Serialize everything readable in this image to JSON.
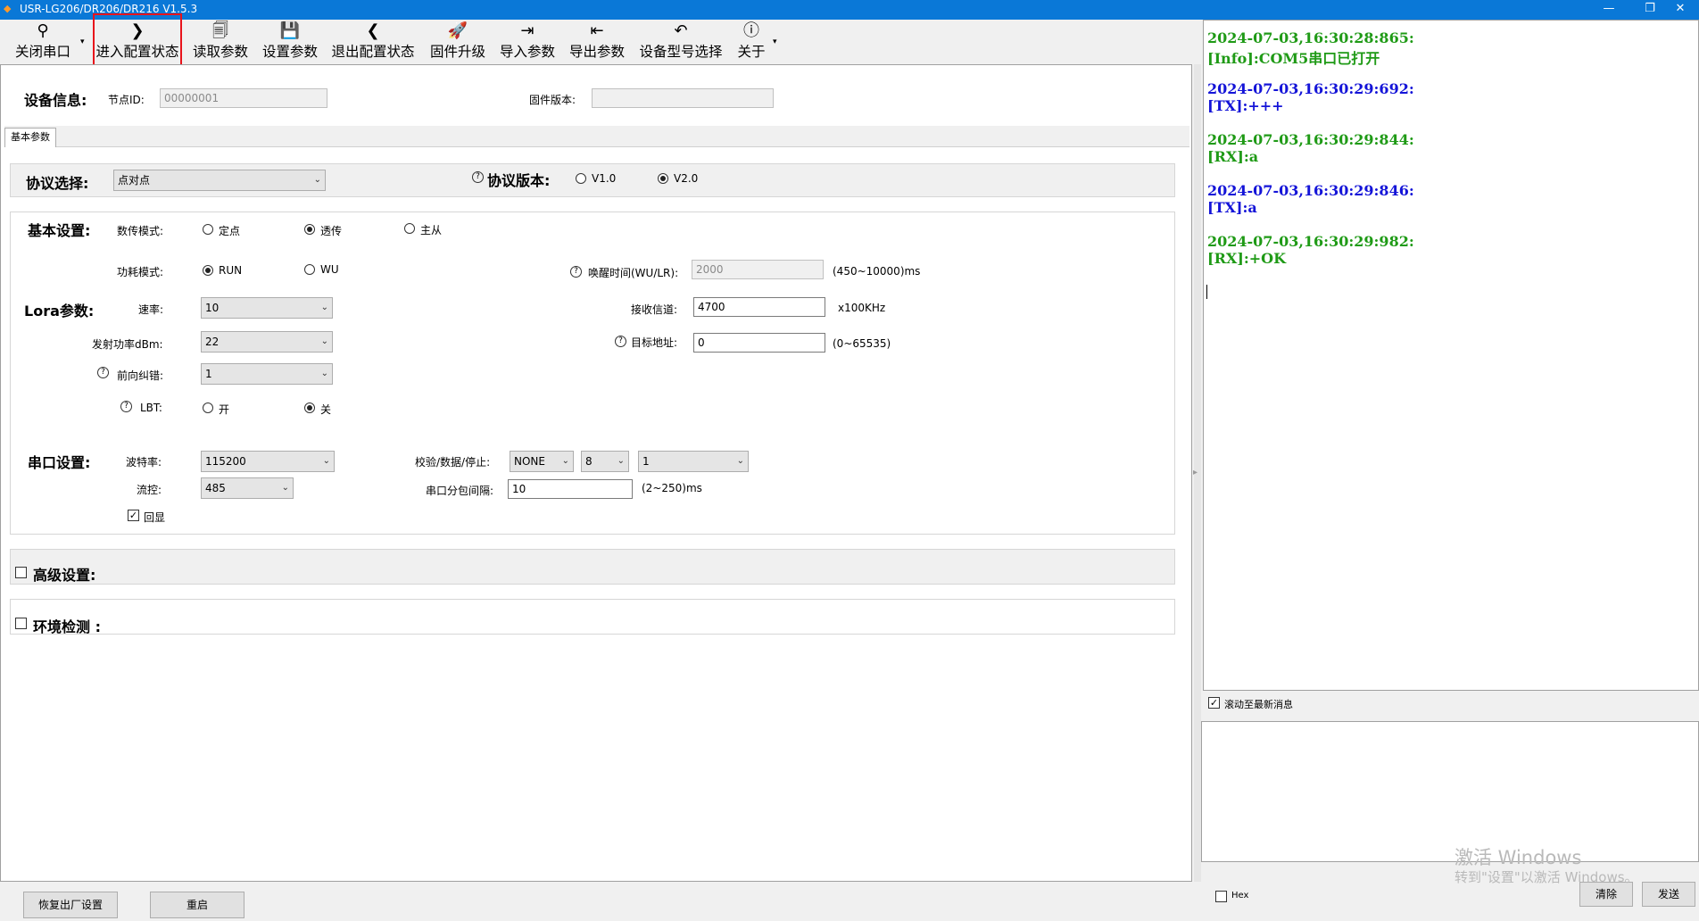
{
  "window": {
    "title": "USR-LG206/DR206/DR216 V1.5.3",
    "minimize": "—",
    "restore": "❐",
    "close": "✕"
  },
  "toolbar": {
    "items": [
      {
        "label": "关闭串口",
        "icon": "⚲"
      },
      {
        "label": "进入配置状态",
        "icon": "❯"
      },
      {
        "label": "读取参数",
        "icon": "🗐"
      },
      {
        "label": "设置参数",
        "icon": "💾"
      },
      {
        "label": "退出配置状态",
        "icon": "❮"
      },
      {
        "label": "固件升级",
        "icon": "🚀"
      },
      {
        "label": "导入参数",
        "icon": "⇥"
      },
      {
        "label": "导出参数",
        "icon": "⇤"
      },
      {
        "label": "设备型号选择",
        "icon": "↶"
      },
      {
        "label": "关于",
        "icon": "ⓘ"
      }
    ],
    "dropdown": "▾"
  },
  "device_info": {
    "label": "设备信息:",
    "node_id_label": "节点ID:",
    "node_id_value": "00000001",
    "firmware_label": "固件版本:",
    "firmware_value": ""
  },
  "tabs": {
    "basic": "基本参数"
  },
  "protocol": {
    "label": "协议选择:",
    "selected": "点对点",
    "version_label": "协议版本:",
    "v1": "V1.0",
    "v2": "V2.0",
    "version_selected": "V2.0"
  },
  "basic_settings": {
    "label": "基本设置:",
    "data_mode_label": "数传模式:",
    "mode_fixed": "定点",
    "mode_transparent": "透传",
    "mode_master_slave": "主从",
    "data_mode_selected": "透传",
    "power_mode_label": "功耗模式:",
    "power_run": "RUN",
    "power_wu": "WU",
    "power_selected": "RUN",
    "wake_time_label": "唤醒时间(WU/LR):",
    "wake_time_value": "2000",
    "wake_time_range": "(450~10000)ms"
  },
  "lora": {
    "label": "Lora参数:",
    "rate_label": "速率:",
    "rate_value": "10",
    "tx_power_label": "发射功率dBm:",
    "tx_power_value": "22",
    "fec_label": "前向纠错:",
    "fec_value": "1",
    "lbt_label": "LBT:",
    "lbt_on": "开",
    "lbt_off": "关",
    "lbt_selected": "关",
    "rx_channel_label": "接收信道:",
    "rx_channel_value": "4700",
    "rx_channel_unit": "x100KHz",
    "target_addr_label": "目标地址:",
    "target_addr_value": "0",
    "target_addr_range": "(0~65535)"
  },
  "serial": {
    "label": "串口设置:",
    "baud_label": "波特率:",
    "baud_value": "115200",
    "flow_label": "流控:",
    "flow_value": "485",
    "echo_label": "回显",
    "echo_checked": true,
    "parity_label": "校验/数据/停止:",
    "parity_value": "NONE",
    "databits_value": "8",
    "stopbits_value": "1",
    "packet_interval_label": "串口分包间隔:",
    "packet_interval_value": "10",
    "packet_interval_range": "(2~250)ms"
  },
  "advanced": {
    "label": "高级设置:"
  },
  "environment": {
    "label": "环境检测 :"
  },
  "bottom_buttons": {
    "factory_reset": "恢复出厂设置",
    "restart": "重启"
  },
  "log": {
    "entries": [
      {
        "time": "2024-07-03,16:30:28:865:",
        "msg": "[Info]:COM5串口已打开",
        "color": "#1f9a16"
      },
      {
        "time": "2024-07-03,16:30:29:692:",
        "msg": "[TX]:+++",
        "color": "#1414d8"
      },
      {
        "time": "2024-07-03,16:30:29:844:",
        "msg": "[RX]:a",
        "color": "#1f9a16"
      },
      {
        "time": "2024-07-03,16:30:29:846:",
        "msg": "[TX]:a",
        "color": "#1414d8"
      },
      {
        "time": "2024-07-03,16:30:29:982:",
        "msg": "[RX]:+OK",
        "color": "#1f9a16"
      }
    ],
    "scroll_latest_label": "滚动至最新消息",
    "hex_label": "Hex",
    "clear_button": "清除",
    "send_button": "发送"
  },
  "watermark": {
    "line1": "激活 Windows",
    "line2": "转到\"设置\"以激活 Windows。"
  }
}
